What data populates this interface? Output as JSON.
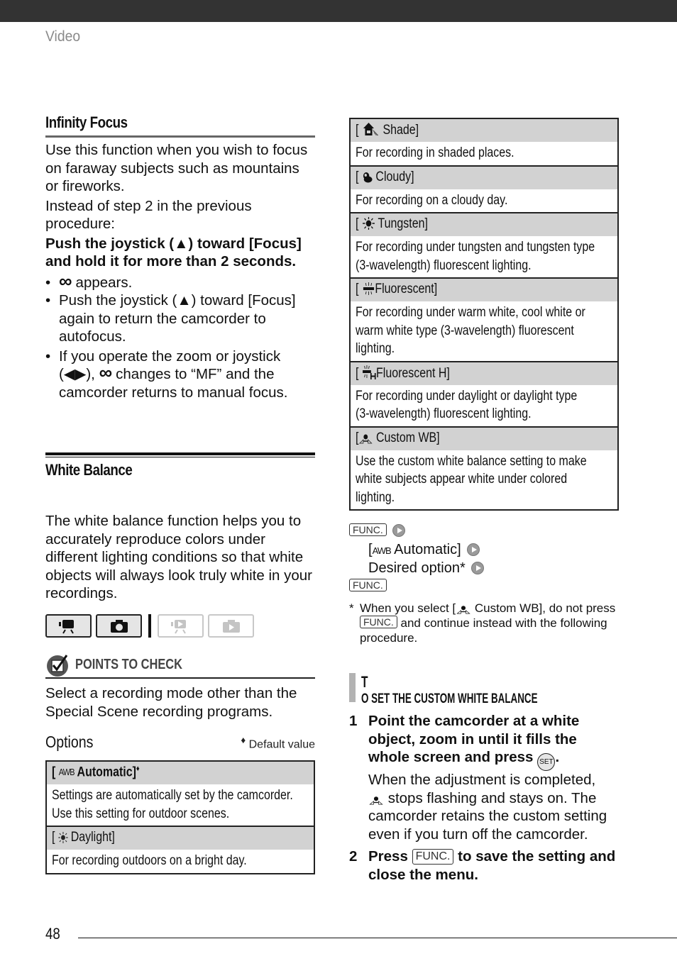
{
  "header": {
    "section": "Video"
  },
  "infinity_focus": {
    "title": "Infinity Focus",
    "intro1": "Use this function when you wish to focus on faraway subjects such as mountains or fireworks.",
    "intro2": "Instead of step 2 in the previous procedure:",
    "instruction": "Push the joystick (▲) toward [Focus] and hold it for more than 2 seconds.",
    "bullets": [
      {
        "icon": "infinity-icon",
        "text": "appears."
      },
      {
        "text": "Push the joystick (▲) toward [Focus] again to return the camcorder to autofocus."
      },
      {
        "pre": "If you operate the zoom or joystick (◀▶),",
        "icon": "infinity-icon",
        "text": "changes to “MF” and the camcorder returns to manual focus."
      }
    ],
    "infinity_glyph": "∞"
  },
  "white_balance": {
    "title": "White Balance",
    "intro": "The white balance function helps you to accurately reproduce colors under different lighting conditions so that white objects will always look truly white in your recordings.",
    "modes": [
      {
        "name": "movie-record-mode",
        "active": true
      },
      {
        "name": "photo-record-mode",
        "active": true
      },
      {
        "name": "movie-playback-mode",
        "active": false
      },
      {
        "name": "photo-playback-mode",
        "active": false
      }
    ],
    "points_to_check": {
      "label": "POINTS TO CHECK",
      "text": "Select a recording mode other than the Special Scene recording programs."
    },
    "options_label": "Options",
    "default_note": "Default value",
    "default_mark": "♦",
    "options": [
      {
        "icon": "awb-icon",
        "label": "Automatic]",
        "prefix": "[",
        "default": true,
        "description_lines": [
          "Settings are automatically set by the camcorder.",
          "Use this setting for outdoor scenes."
        ]
      },
      {
        "icon": "daylight-icon",
        "label": "Daylight]",
        "prefix": "[",
        "description_lines": [
          "For recording outdoors on a bright day."
        ]
      },
      {
        "icon": "shade-icon",
        "label": "Shade]",
        "prefix": "[",
        "description_lines": [
          "For recording in shaded places."
        ]
      },
      {
        "icon": "cloudy-icon",
        "label": "Cloudy]",
        "prefix": "[",
        "description_lines": [
          "For recording on a cloudy day."
        ]
      },
      {
        "icon": "tungsten-icon",
        "label": "Tungsten]",
        "prefix": "[",
        "description_lines": [
          "For recording under tungsten and tungsten type",
          "(3-wavelength) fluorescent lighting."
        ]
      },
      {
        "icon": "fluorescent-icon",
        "label": "Fluorescent]",
        "prefix": "[",
        "description_lines": [
          "For recording under warm white, cool white or",
          "warm white type (3-wavelength) fluorescent",
          "lighting."
        ]
      },
      {
        "icon": "fluorescent-h-icon",
        "label": "Fluorescent H]",
        "prefix": "[",
        "description_lines": [
          "For recording under daylight or daylight type",
          "(3-wavelength) fluorescent lighting."
        ]
      },
      {
        "icon": "custom-wb-icon",
        "label": "Custom WB]",
        "prefix": "[",
        "description_lines": [
          "Use the custom white balance setting to make",
          "white subjects appear white under colored",
          "lighting."
        ]
      }
    ],
    "procedure": {
      "func_label": "FUNC.",
      "line1": "[",
      "awb_text": "Automatic]",
      "desired": "Desired option*",
      "footnote_star": "*",
      "footnote_a": "When you select [",
      "footnote_b": "Custom WB], do not press",
      "footnote_c": "and continue instead with the following procedure."
    },
    "custom_wb": {
      "heading": "To set the custom white balance",
      "steps": [
        {
          "num": "1",
          "bold": "Point the camcorder at a white object, zoom in until it fills the whole screen and press",
          "set_label": "SET",
          "bold_end": ".",
          "detail_pre": "When the adjustment is completed,",
          "detail_post": "stops flashing and stays on. The camcorder retains the custom setting even if you turn off the camcorder."
        },
        {
          "num": "2",
          "bold_a": "Press",
          "func_label": "FUNC.",
          "bold_b": "to save the setting and close the menu."
        }
      ]
    }
  },
  "footer": {
    "page_number": "48"
  }
}
